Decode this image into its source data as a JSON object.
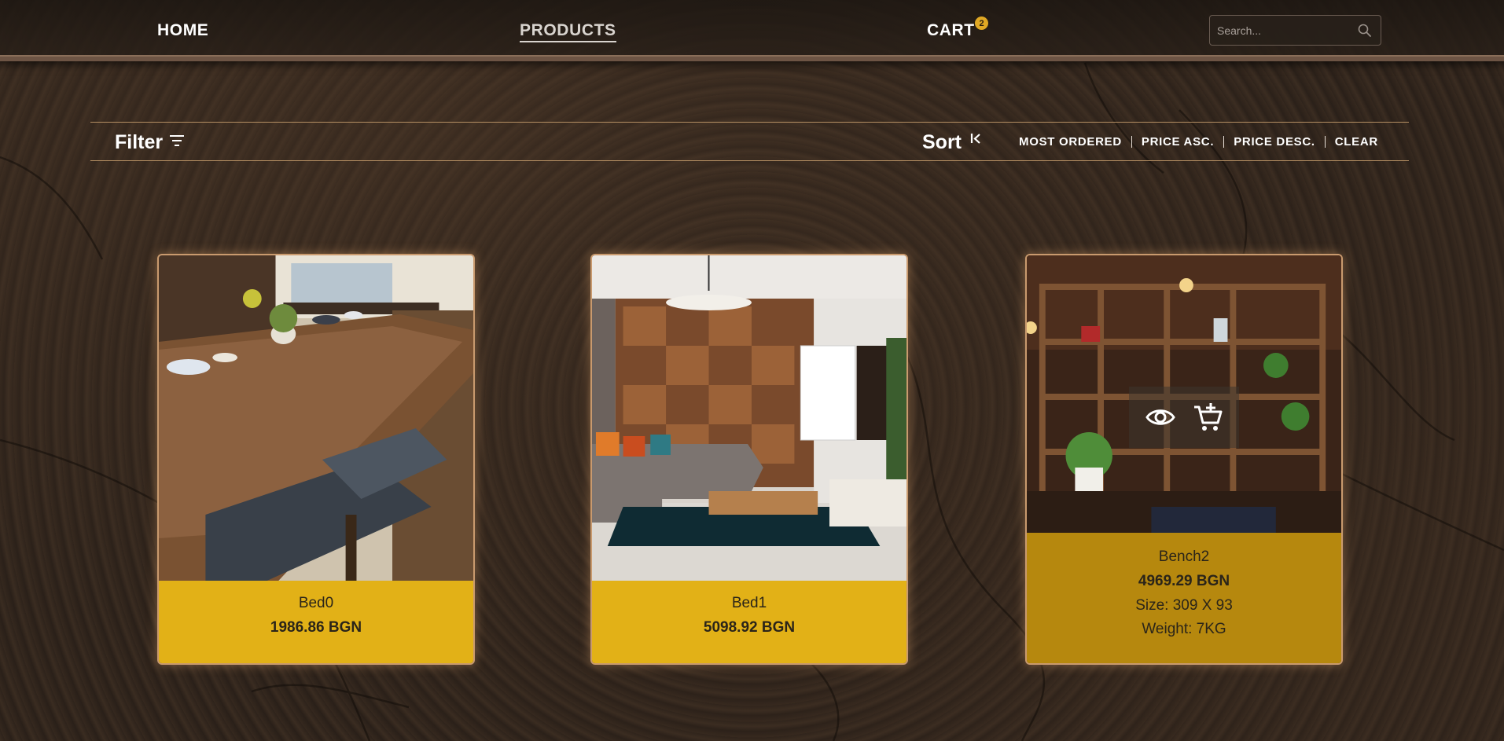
{
  "nav": {
    "home": "HOME",
    "products": "PRODUCTS",
    "cart": "CART",
    "cart_count": "2"
  },
  "search": {
    "placeholder": "Search..."
  },
  "toolbar": {
    "filter_label": "Filter",
    "sort_label": "Sort",
    "sort_options": [
      "MOST ORDERED",
      "PRICE ASC.",
      "PRICE DESC.",
      "CLEAR"
    ]
  },
  "products": [
    {
      "name": "Bed0",
      "price": "1986.86 BGN"
    },
    {
      "name": "Bed1",
      "price": "5098.92 BGN"
    },
    {
      "name": "Bench2",
      "price": "4969.29 BGN",
      "size": "Size: 309 X 93",
      "weight": "Weight: 7KG"
    }
  ],
  "colors": {
    "accent_yellow": "#e2b117",
    "hover_yellow": "#b6880e",
    "badge": "#e0a824",
    "border_tan": "#b58f63"
  }
}
